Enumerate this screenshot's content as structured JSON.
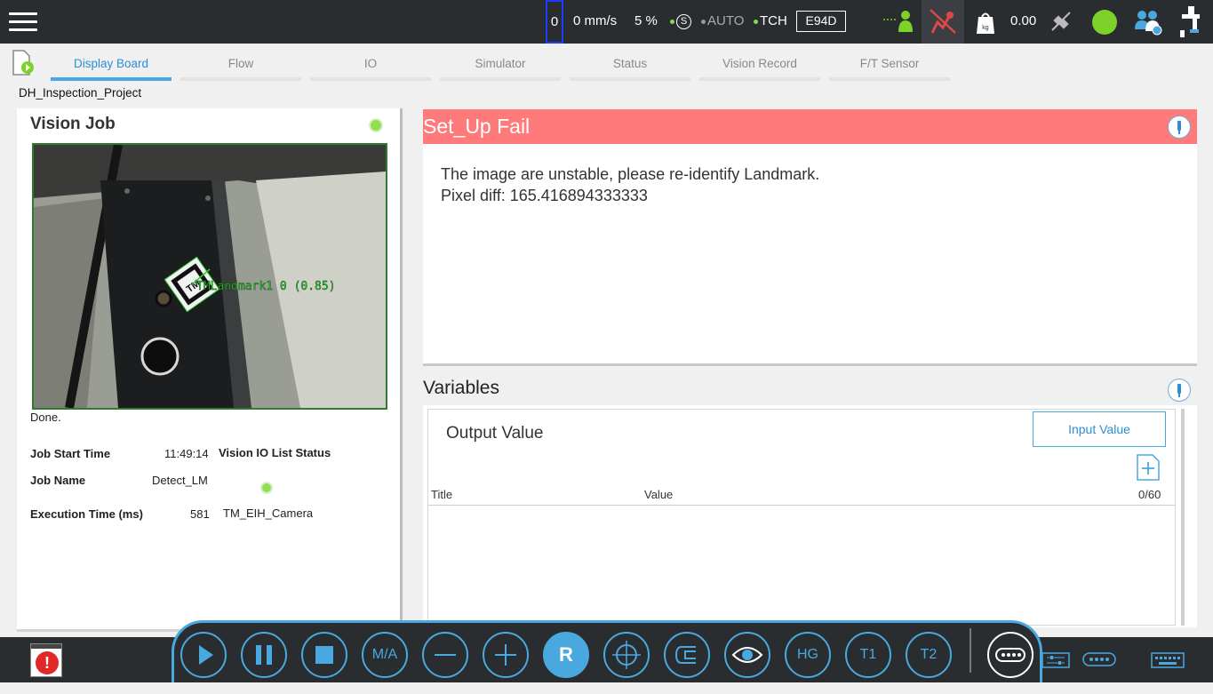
{
  "topbar": {
    "counter": "0",
    "speed": "0 mm/s",
    "percent": "5 %",
    "s_label": "S",
    "mode": "AUTO",
    "tch": "TCH",
    "code": "E94D",
    "payload": "0.00",
    "kg_label": "kg"
  },
  "tabs": [
    {
      "label": "Display Board",
      "active": true
    },
    {
      "label": "Flow"
    },
    {
      "label": "IO"
    },
    {
      "label": "Simulator"
    },
    {
      "label": "Status"
    },
    {
      "label": "Vision Record"
    },
    {
      "label": "F/T Sensor"
    }
  ],
  "project_name": "DH_Inspection_Project",
  "vision_job": {
    "title": "Vision Job",
    "overlay_text": "TMLandmark1 0 (0.85)",
    "marker_text": "TM",
    "status": "Done.",
    "job_start_time_label": "Job Start Time",
    "job_start_time": "11:49:14",
    "job_name_label": "Job Name",
    "job_name": "Detect_LM",
    "execution_time_label": "Execution Time (ms)",
    "execution_time": "581",
    "io_status_label": "Vision IO List Status",
    "camera": "TM_EIH_Camera"
  },
  "setup": {
    "title": "Set_Up Fail",
    "line1": "The image are unstable, please re-identify Landmark.",
    "line2": "Pixel diff: 165.416894333333"
  },
  "variables": {
    "title": "Variables",
    "output_label": "Output Value",
    "input_button": "Input Value",
    "col_title": "Title",
    "col_value": "Value",
    "count": "0/60"
  },
  "dock": {
    "ma": "M/A",
    "r": "R",
    "hg": "HG",
    "t1": "T1",
    "t2": "T2"
  },
  "colors": {
    "accent": "#4aa8e0",
    "error_banner": "#ff7b7b",
    "status_green": "#7dd22a",
    "topbar": "#2a2d30"
  }
}
